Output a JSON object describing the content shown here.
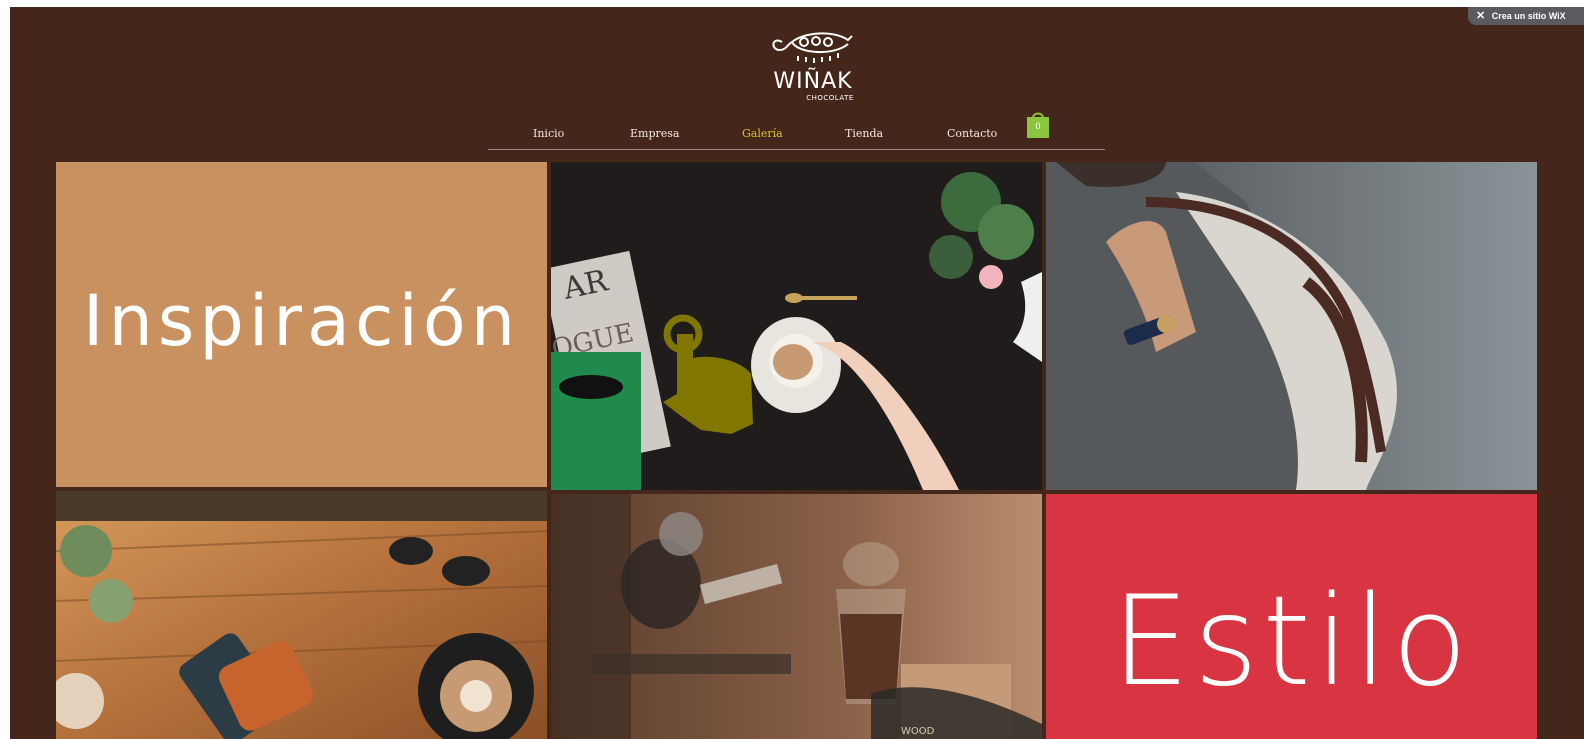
{
  "wix_badge": {
    "label": "Crea un sitio WiX",
    "close_icon": "close-icon"
  },
  "brand": {
    "name": "WIÑAK",
    "subtitle": "CHOCOLATE",
    "logo_icon": "turtle-icon"
  },
  "nav": {
    "items": [
      {
        "label": "Inicio",
        "active": false
      },
      {
        "label": "Empresa",
        "active": false
      },
      {
        "label": "Galería",
        "active": true
      },
      {
        "label": "Tienda",
        "active": false
      },
      {
        "label": "Contacto",
        "active": false
      }
    ],
    "cart": {
      "icon": "shopping-bag-icon",
      "count": "0"
    }
  },
  "gallery": {
    "tiles": [
      {
        "type": "text",
        "text": "Inspiración"
      },
      {
        "type": "photo",
        "subject": "coffee table with magazines, sunglasses and a pointing-hand overlay",
        "icon": "pointing-hand-icon"
      },
      {
        "type": "photo",
        "subject": "man carrying leather bag"
      },
      {
        "type": "photo",
        "subject": "wooden table with wallet, phone, sunglasses and cappuccino"
      },
      {
        "type": "photo",
        "subject": "cafe scene with glass of coffee"
      },
      {
        "type": "text",
        "text": "Estilo"
      }
    ]
  },
  "colors": {
    "background": "#45261a",
    "inspiracion_tile": "#c9915f",
    "estilo_tile": "#d83442",
    "nav_active": "#d6c23a",
    "cart": "#8cc63f"
  }
}
